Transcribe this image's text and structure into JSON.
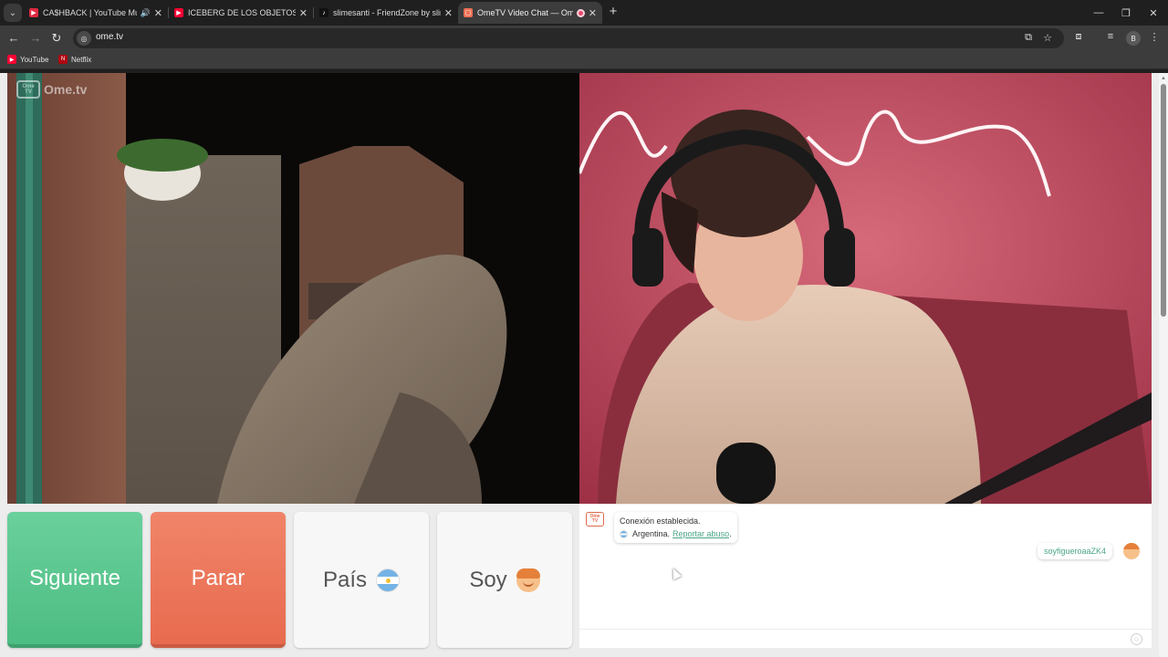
{
  "browser": {
    "tabs": [
      {
        "title": "CA$HBACK | YouTube Music",
        "favicon": "youtube-music",
        "color": "#e02a40"
      },
      {
        "title": "ICEBERG DE LOS OBJETOS PERDIDOS",
        "favicon": "youtube",
        "color": "#ff0033"
      },
      {
        "title": "slimesanti - FriendZone by slimesanti",
        "favicon": "tiktok",
        "color": "#111111"
      },
      {
        "title": "OmeTV Video Chat — Omegle",
        "favicon": "ometv",
        "color": "#f07055"
      }
    ],
    "url": "ome.tv",
    "profile_initial": "B",
    "bookmarks": [
      {
        "label": "YouTube",
        "icon": "youtube",
        "color": "#ff0033"
      },
      {
        "label": "Netflix",
        "icon": "netflix",
        "color": "#b00610"
      }
    ]
  },
  "site": {
    "logo_text": "Ome.tv",
    "logo_badge": "Ome TV"
  },
  "controls": {
    "next_label": "Siguiente",
    "stop_label": "Parar",
    "country_label": "País",
    "gender_label": "Soy"
  },
  "chat": {
    "system_logo": "Ome TV",
    "connection_message": "Conexión establecida.",
    "country": "Argentina.",
    "report_link": "Reportar abuso",
    "report_suffix": ".",
    "user_message": "soyfigueroaaZK4"
  },
  "colors": {
    "next_button": "#5cc790",
    "stop_button": "#ec7659",
    "link": "#4aa587"
  }
}
